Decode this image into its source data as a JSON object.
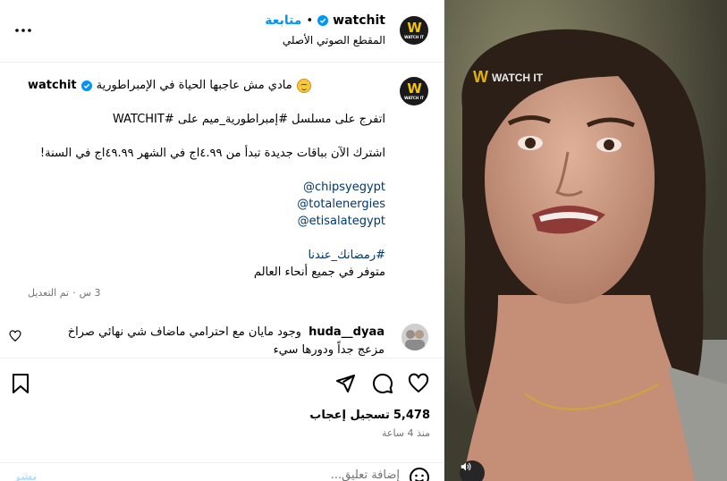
{
  "header": {
    "username": "watchit",
    "dot": "•",
    "follow_label": "متابعة",
    "audio_label": "المقطع الصوتي الأصلي"
  },
  "caption": {
    "username": "watchit",
    "first_line": "مادي مش عاجبها الحياة في الإمبراطورية",
    "line_watch": "اتفرج على مسلسل #إمبراطورية_ميم على #WATCHIT",
    "line_subscribe": "اشترك الآن بباقات جديدة تبدأ من ٤.٩٩اج في الشهر ٤٩.٩٩اج في السنة!",
    "mentions": [
      "chipsyegypt@",
      "totalenergies@",
      "etisalategypt@"
    ],
    "hashtag": "#رمضانك_عندنا",
    "available": "متوفر في جميع أنحاء العالم",
    "edited_label": "تم التعديل",
    "edited_dot": "·",
    "edited_time": "3 س"
  },
  "comment": {
    "username": "huda__dyaa",
    "text": "وجود مايان مع احترامي ماضاف شي نهائي صراخ مزعج جداً ودورها سيء"
  },
  "actions": {
    "likes_count": "5,478",
    "likes_label": "تسجيل إعجاب",
    "time_ago": "منذ 4 ساعة",
    "comment_placeholder": "إضافة تعليق...",
    "post_label": "نشر"
  },
  "video": {
    "watermark": "WATCH IT"
  },
  "colors": {
    "follow_blue": "#0095f6",
    "link_blue": "#00376b",
    "muted_gray": "#737373",
    "brand_yellow": "#f4c400"
  },
  "icons": {
    "more": "more-horizontal-icon",
    "verified": "verified-badge-icon",
    "heart": "heart-icon",
    "comment": "comment-icon",
    "share": "send-icon",
    "save": "bookmark-icon",
    "emoji": "emoji-smile-icon",
    "mute": "speaker-icon"
  }
}
